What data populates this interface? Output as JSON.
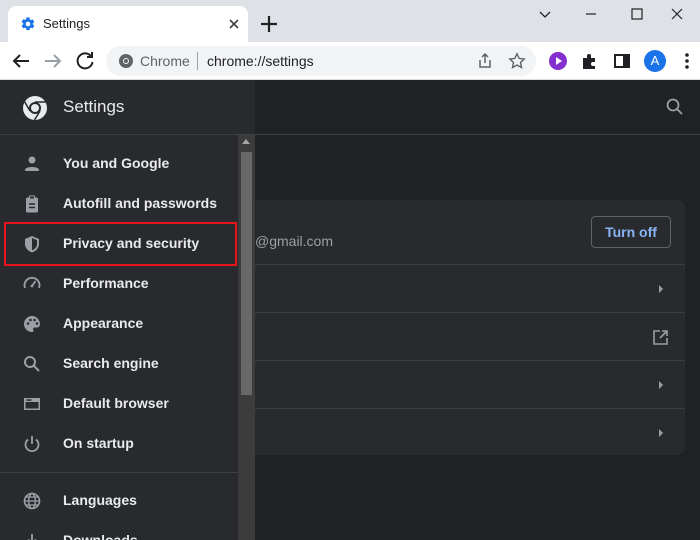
{
  "browser": {
    "tab_title": "Settings",
    "omnibox_host": "Chrome",
    "omnibox_url": "chrome://settings",
    "avatar_initial": "A"
  },
  "drawer": {
    "title": "Settings",
    "items": [
      {
        "label": "You and Google",
        "icon": "person-icon"
      },
      {
        "label": "Autofill and passwords",
        "icon": "clipboard-icon"
      },
      {
        "label": "Privacy and security",
        "icon": "shield-icon"
      },
      {
        "label": "Performance",
        "icon": "speedometer-icon"
      },
      {
        "label": "Appearance",
        "icon": "palette-icon"
      },
      {
        "label": "Search engine",
        "icon": "search-icon"
      },
      {
        "label": "Default browser",
        "icon": "browser-icon"
      },
      {
        "label": "On startup",
        "icon": "power-icon"
      },
      {
        "label": "Languages",
        "icon": "globe-icon"
      },
      {
        "label": "Downloads",
        "icon": "download-icon"
      }
    ],
    "highlight_color": "#e8141c"
  },
  "main": {
    "account_email": "@gmail.com",
    "turn_off_label": "Turn off"
  },
  "colors": {
    "accent": "#8ab4f8",
    "background": "#202124",
    "surface": "#292a2d"
  }
}
